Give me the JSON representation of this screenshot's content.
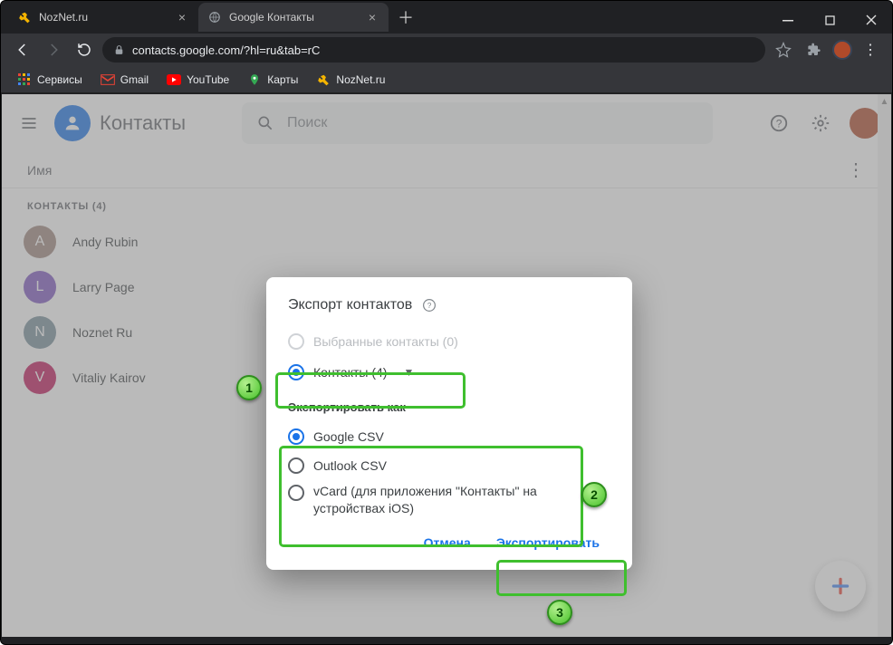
{
  "window": {
    "tab1": "NozNet.ru",
    "tab2": "Google Контакты"
  },
  "address": {
    "url": "contacts.google.com/?hl=ru&tab=rC"
  },
  "bookmarks": {
    "apps": "Сервисы",
    "gmail": "Gmail",
    "youtube": "YouTube",
    "maps": "Карты",
    "noznet": "NozNet.ru"
  },
  "app": {
    "title": "Контакты",
    "search_placeholder": "Поиск"
  },
  "list": {
    "header": "Имя",
    "section": "КОНТАКТЫ (4)"
  },
  "contacts": [
    {
      "initial": "A",
      "name": "Andy Rubin",
      "color": "#a1887f"
    },
    {
      "initial": "L",
      "name": "Larry Page",
      "color": "#7e57c2"
    },
    {
      "initial": "N",
      "name": "Noznet Ru",
      "color": "#78909c"
    },
    {
      "initial": "V",
      "name": "Vitaliy Kairov",
      "color": "#c2185b"
    }
  ],
  "dialog": {
    "title": "Экспорт контактов",
    "opt_selected_disabled": "Выбранные контакты (0)",
    "opt_contacts": "Контакты (4)",
    "format_label": "Экспортировать как",
    "fmt_google": "Google CSV",
    "fmt_outlook": "Outlook CSV",
    "fmt_vcard": "vCard (для приложения \"Контакты\" на устройствах iOS)",
    "cancel": "Отмена",
    "export": "Экспортировать"
  },
  "callouts": {
    "c1": "1",
    "c2": "2",
    "c3": "3"
  }
}
